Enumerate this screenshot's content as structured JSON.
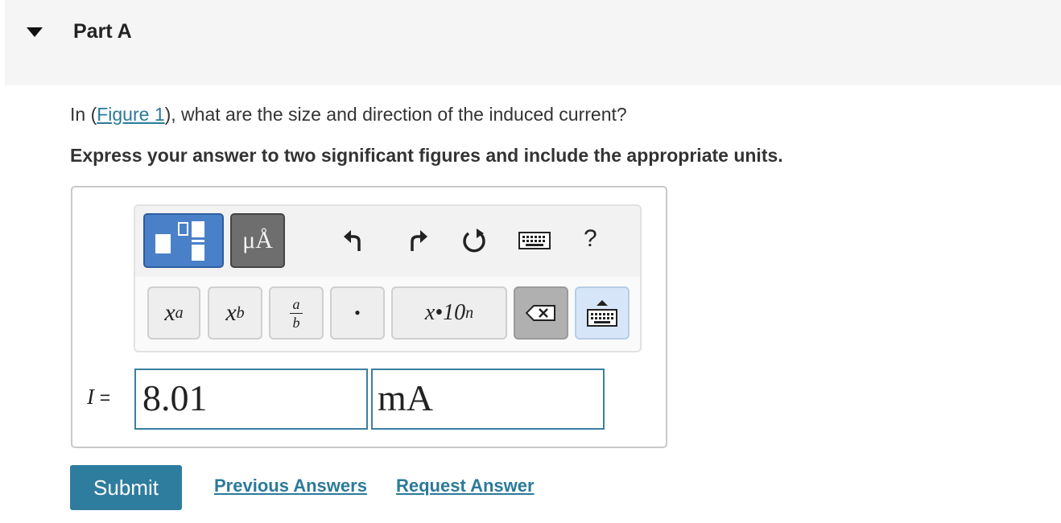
{
  "part": {
    "title": "Part A"
  },
  "question": {
    "prefix": "In (",
    "figure_link": "Figure 1",
    "suffix": "), what are the size and direction of the induced current?"
  },
  "instruction": "Express your answer to two significant figures and include the appropriate units.",
  "toolbar": {
    "units_label": "μÅ",
    "help_label": "?",
    "keys": {
      "superscript_base": "x",
      "superscript_exp": "a",
      "subscript_base": "x",
      "subscript_sub": "b",
      "fraction_num": "a",
      "fraction_den": "b",
      "dot": "•",
      "sci_notation": "x•10",
      "sci_exp": "n"
    }
  },
  "answer": {
    "variable": "I",
    "equals": "=",
    "value": "8.01",
    "units": "mA"
  },
  "actions": {
    "submit_label": "Submit",
    "previous_answers_label": "Previous Answers",
    "request_answer_label": "Request Answer"
  },
  "colors": {
    "accent": "#2f7d9e",
    "template_button": "#4a80c8",
    "units_button": "#6e6e6e",
    "header_bg": "#f5f5f5"
  },
  "icons": [
    "templates-icon",
    "undo-icon",
    "redo-icon",
    "reset-icon",
    "keyboard-icon",
    "backspace-icon",
    "keyboard-toggle-icon"
  ]
}
